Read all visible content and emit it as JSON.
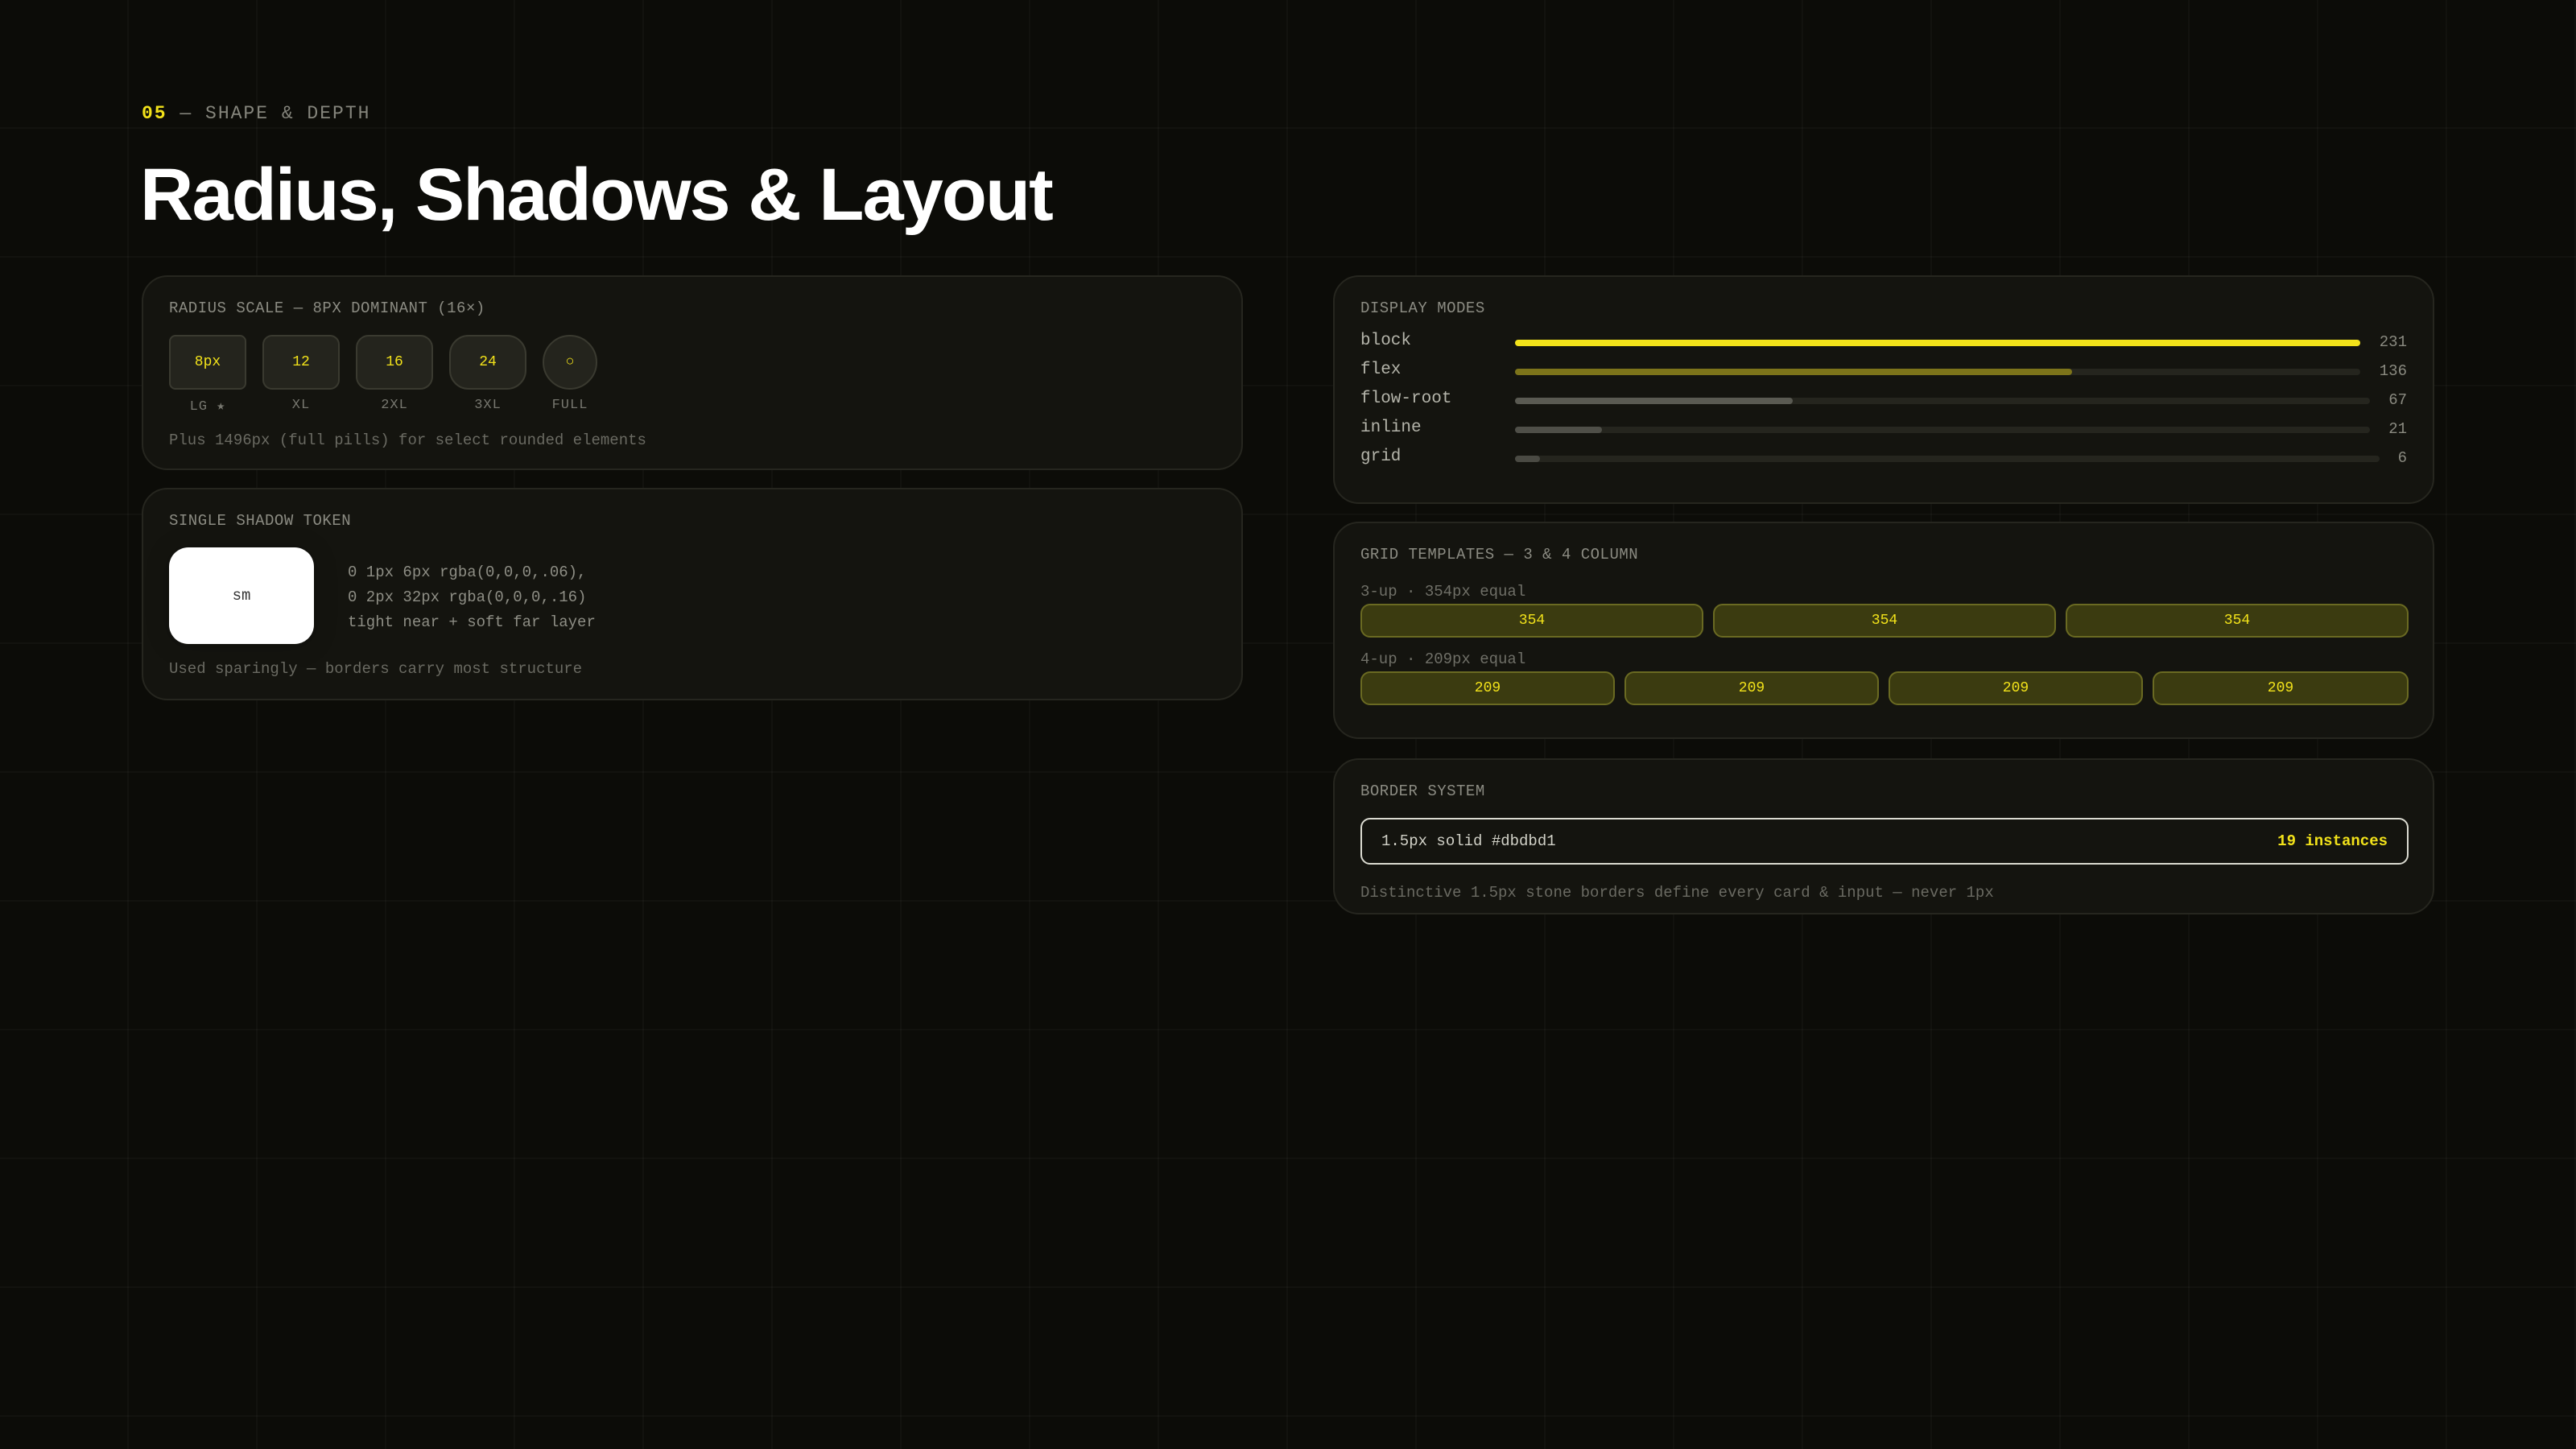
{
  "header": {
    "section_number": "05",
    "section_rest": " — SHAPE & DEPTH",
    "title": "Radius, Shadows & Layout"
  },
  "radius": {
    "label": "RADIUS SCALE — 8PX DOMINANT (16×)",
    "chips": [
      {
        "value": "8px",
        "caption": "LG ★"
      },
      {
        "value": "12",
        "caption": "XL"
      },
      {
        "value": "16",
        "caption": "2XL"
      },
      {
        "value": "24",
        "caption": "3XL"
      },
      {
        "value": "○",
        "caption": "FULL"
      }
    ],
    "note": "Plus 1496px (full pills) for select rounded elements"
  },
  "shadow": {
    "label": "SINGLE SHADOW TOKEN",
    "sample_label": "sm",
    "spec_lines": [
      "0 1px 6px rgba(0,0,0,.06),",
      "0 2px 32px rgba(0,0,0,.16)",
      "tight near + soft far layer"
    ],
    "note": "Used sparingly — borders carry most structure"
  },
  "display_modes": {
    "label": "DISPLAY MODES",
    "max": 231,
    "rows": [
      {
        "name": "block",
        "count": 231,
        "color": "#f2e21a"
      },
      {
        "name": "flex",
        "count": 136,
        "color": "#7d741a"
      },
      {
        "name": "flow-root",
        "count": 67,
        "color": "#5a5a52"
      },
      {
        "name": "inline",
        "count": 21,
        "color": "#4f4f48"
      },
      {
        "name": "grid",
        "count": 6,
        "color": "#4a4a43"
      }
    ]
  },
  "grid_templates": {
    "label": "GRID TEMPLATES — 3 & 4 COLUMN",
    "three_up": {
      "label": "3-up · 354px equal",
      "cells": [
        "354",
        "354",
        "354"
      ]
    },
    "four_up": {
      "label": "4-up · 209px equal",
      "cells": [
        "209",
        "209",
        "209",
        "209"
      ]
    }
  },
  "border_system": {
    "label": "BORDER SYSTEM",
    "spec": "1.5px solid #dbdbd1",
    "count": "19 instances",
    "note": "Distinctive 1.5px stone borders define every card & input — never 1px"
  },
  "colors": {
    "background": "#0c0c08",
    "accent": "#f2e21a",
    "border_stone": "#dbdbd1"
  }
}
